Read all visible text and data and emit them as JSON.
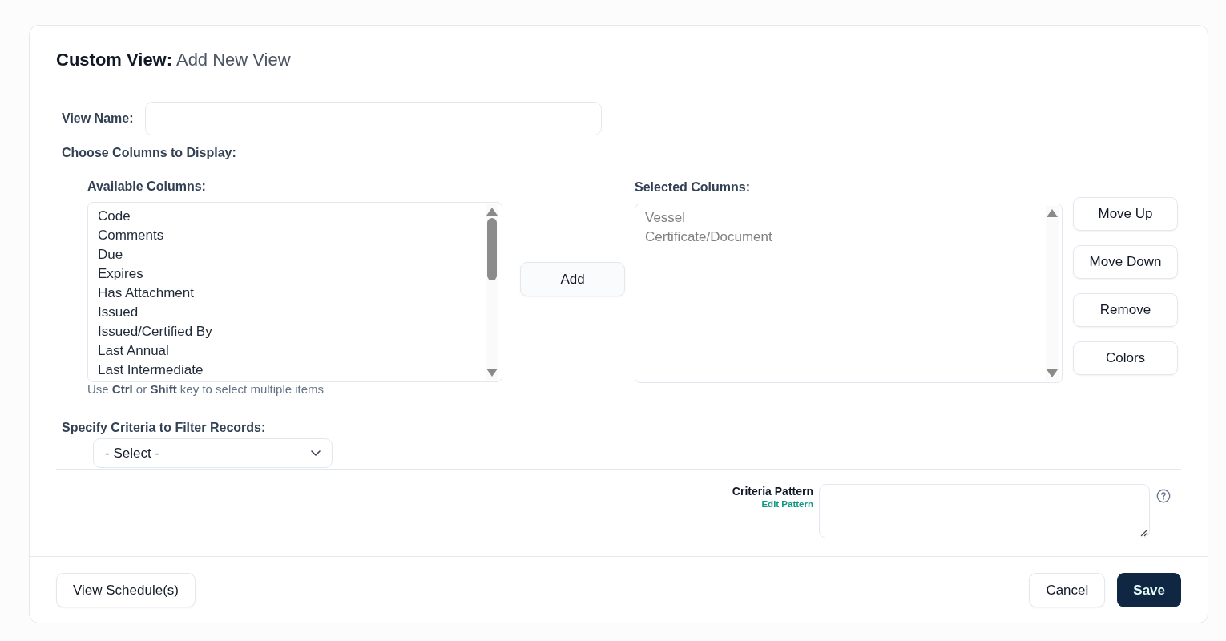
{
  "dialog": {
    "title": "Custom View:",
    "subtitle": "Add New View"
  },
  "view_name": {
    "label": "View Name:"
  },
  "choose_columns": {
    "heading": "Choose Columns to Display:",
    "available": {
      "label": "Available Columns:",
      "items": [
        {
          "label": "Code",
          "selected": false
        },
        {
          "label": "Comments",
          "selected": false
        },
        {
          "label": "Due",
          "selected": false
        },
        {
          "label": "Expires",
          "selected": false
        },
        {
          "label": "Has Attachment",
          "selected": false
        },
        {
          "label": "Issued",
          "selected": false
        },
        {
          "label": "Issued/Certified By",
          "selected": false
        },
        {
          "label": "Last Annual",
          "selected": false
        },
        {
          "label": "Last Intermediate",
          "selected": false
        }
      ],
      "hint": "Use **Ctrl** or **Shift** key to select multiple items"
    },
    "add_button": "Add",
    "selected": {
      "label": "Selected Columns:",
      "items": [
        {
          "label": "Vessel",
          "selected": false
        },
        {
          "label": "Certificate/Document",
          "selected": false
        }
      ]
    },
    "actions": [
      "Move Up",
      "Move Down",
      "Remove",
      "Colors"
    ]
  },
  "criteria": {
    "heading": "Specify Criteria to Filter Records:",
    "select": {
      "value": "- Select -"
    },
    "pattern": {
      "label": "Criteria Pattern",
      "link": "Edit Pattern"
    }
  },
  "footer": {
    "left_buttons": [
      {
        "label": "View Schedule(s)",
        "kind": "secondary"
      }
    ],
    "right_buttons": [
      {
        "label": "Cancel",
        "kind": "secondary"
      },
      {
        "label": "Save",
        "kind": "primary"
      }
    ]
  }
}
